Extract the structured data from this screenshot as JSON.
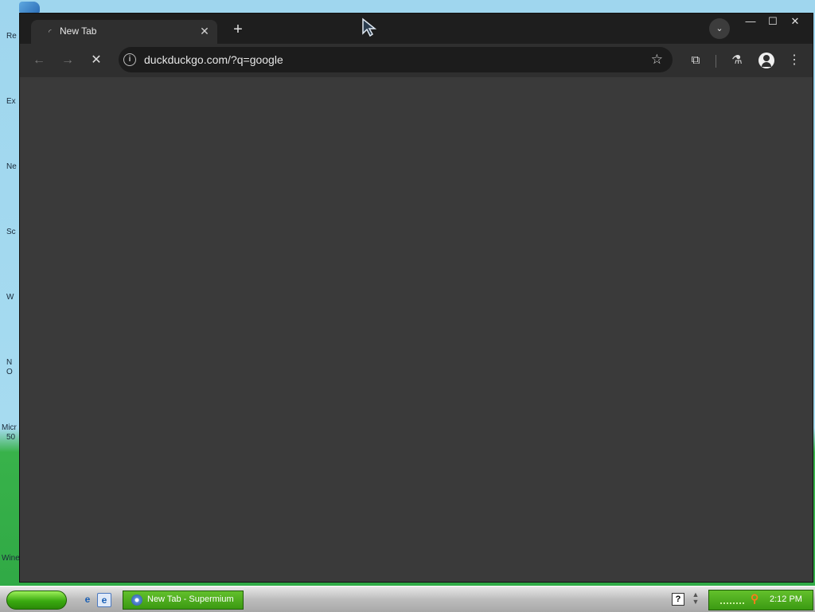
{
  "desktop": {
    "peek_labels": [
      "Re",
      "Ex",
      "Ne",
      "Sc",
      "W",
      "N",
      "O",
      "Micr",
      "50",
      "Wine"
    ]
  },
  "browser": {
    "tab": {
      "title": "New Tab"
    },
    "omnibox": {
      "url": "duckduckgo.com/?q=google"
    },
    "window_controls": [
      "minimize",
      "maximize",
      "close"
    ]
  },
  "taskbar": {
    "task_item_label": "New Tab - Supermium",
    "help_label": "?",
    "clock": "2:12 PM"
  },
  "icons": {
    "back": "arrow-left",
    "forward": "arrow-right",
    "stop": "x",
    "site_info": "info",
    "bookmark": "star",
    "extensions": "puzzle",
    "labs": "flask",
    "profile": "person",
    "menu": "three-dots"
  },
  "colors": {
    "tabbar": "#1e1e1e",
    "toolbar": "#2f2f2f",
    "omnibox": "#1c1c1c",
    "content": "#3a3a3a",
    "taskbar_green": "#3b9a12"
  }
}
